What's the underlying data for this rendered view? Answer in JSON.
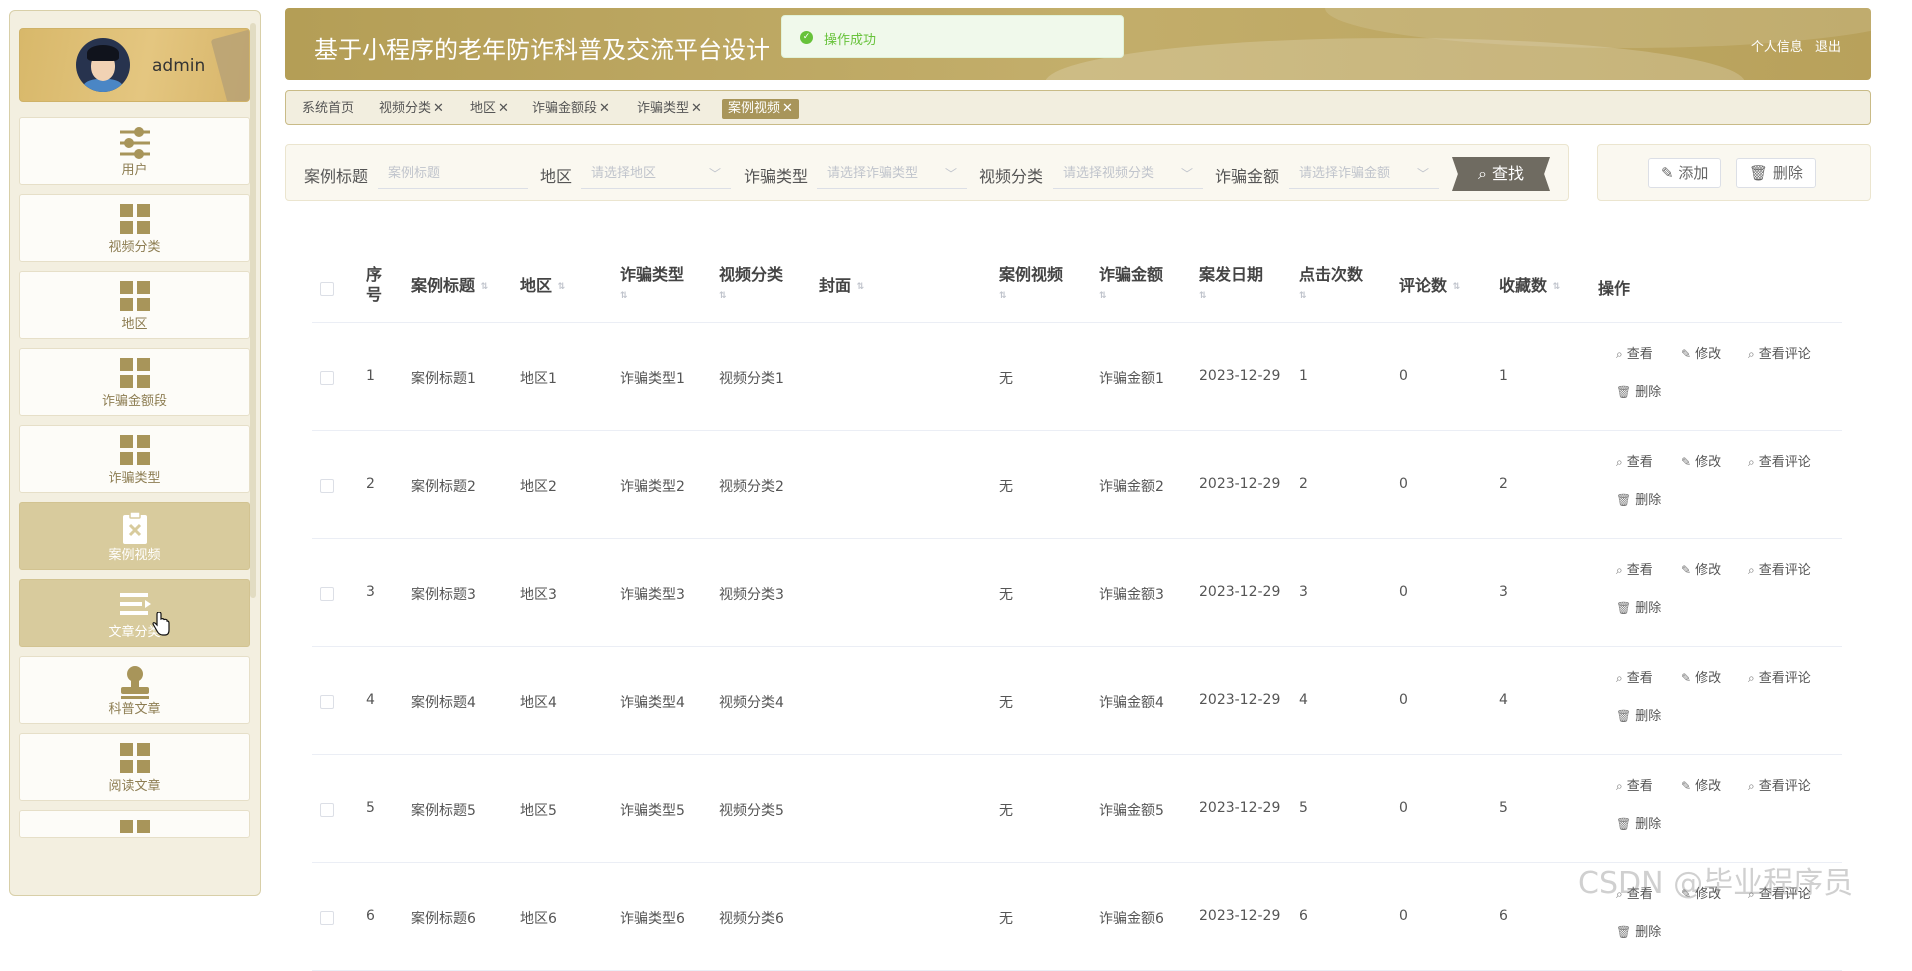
{
  "user": {
    "name": "admin"
  },
  "menu": [
    {
      "label": "用户",
      "icon": "sliders-icon",
      "active": false
    },
    {
      "label": "视频分类",
      "icon": "grid-icon",
      "active": false
    },
    {
      "label": "地区",
      "icon": "grid-icon",
      "active": false
    },
    {
      "label": "诈骗金额段",
      "icon": "grid-icon",
      "active": false
    },
    {
      "label": "诈骗类型",
      "icon": "grid-icon",
      "active": false
    },
    {
      "label": "案例视频",
      "icon": "clipboard-x-icon",
      "active": true
    },
    {
      "label": "文章分类",
      "icon": "list-icon",
      "active": true
    },
    {
      "label": "科普文章",
      "icon": "stamp-icon",
      "active": false
    },
    {
      "label": "阅读文章",
      "icon": "grid-icon",
      "active": false
    }
  ],
  "header": {
    "title": "基于小程序的老年防诈科普及交流平台设计",
    "profile_link": "个人信息",
    "logout_link": "退出"
  },
  "toast": {
    "message": "操作成功",
    "icon": "check-circle-icon",
    "color": "#67c23a"
  },
  "tabs": [
    {
      "label": "系统首页",
      "closable": false,
      "active": false
    },
    {
      "label": "视频分类",
      "closable": true,
      "active": false
    },
    {
      "label": "地区",
      "closable": true,
      "active": false
    },
    {
      "label": "诈骗金额段",
      "closable": true,
      "active": false
    },
    {
      "label": "诈骗类型",
      "closable": true,
      "active": false
    },
    {
      "label": "案例视频",
      "closable": true,
      "active": true
    }
  ],
  "search": {
    "title_label": "案例标题",
    "title_placeholder": "案例标题",
    "region_label": "地区",
    "region_placeholder": "请选择地区",
    "type_label": "诈骗类型",
    "type_placeholder": "请选择诈骗类型",
    "category_label": "视频分类",
    "category_placeholder": "请选择视频分类",
    "amount_label": "诈骗金额",
    "amount_placeholder": "请选择诈骗金额",
    "find_button": "查找"
  },
  "actions": {
    "add": "添加",
    "delete": "删除"
  },
  "table": {
    "headers": {
      "index": "序号",
      "title": "案例标题",
      "region": "地区",
      "type": "诈骗类型",
      "category": "视频分类",
      "cover": "封面",
      "video": "案例视频",
      "amount": "诈骗金额",
      "date": "案发日期",
      "clicks": "点击次数",
      "comments": "评论数",
      "favorites": "收藏数",
      "ops": "操作"
    },
    "op_labels": {
      "view": "查看",
      "edit": "修改",
      "view_comments": "查看评论",
      "delete": "删除"
    },
    "rows": [
      {
        "index": "1",
        "title": "案例标题1",
        "region": "地区1",
        "type": "诈骗类型1",
        "category": "视频分类1",
        "video": "无",
        "amount": "诈骗金额1",
        "date": "2023-12-29",
        "clicks": "1",
        "comments": "0",
        "favorites": "1"
      },
      {
        "index": "2",
        "title": "案例标题2",
        "region": "地区2",
        "type": "诈骗类型2",
        "category": "视频分类2",
        "video": "无",
        "amount": "诈骗金额2",
        "date": "2023-12-29",
        "clicks": "2",
        "comments": "0",
        "favorites": "2"
      },
      {
        "index": "3",
        "title": "案例标题3",
        "region": "地区3",
        "type": "诈骗类型3",
        "category": "视频分类3",
        "video": "无",
        "amount": "诈骗金额3",
        "date": "2023-12-29",
        "clicks": "3",
        "comments": "0",
        "favorites": "3"
      },
      {
        "index": "4",
        "title": "案例标题4",
        "region": "地区4",
        "type": "诈骗类型4",
        "category": "视频分类4",
        "video": "无",
        "amount": "诈骗金额4",
        "date": "2023-12-29",
        "clicks": "4",
        "comments": "0",
        "favorites": "4"
      },
      {
        "index": "5",
        "title": "案例标题5",
        "region": "地区5",
        "type": "诈骗类型5",
        "category": "视频分类5",
        "video": "无",
        "amount": "诈骗金额5",
        "date": "2023-12-29",
        "clicks": "5",
        "comments": "0",
        "favorites": "5"
      },
      {
        "index": "6",
        "title": "案例标题6",
        "region": "地区6",
        "type": "诈骗类型6",
        "category": "视频分类6",
        "video": "无",
        "amount": "诈骗金额6",
        "date": "2023-12-29",
        "clicks": "6",
        "comments": "0",
        "favorites": "6"
      }
    ]
  },
  "watermark": "CSDN @毕业程序员",
  "colors": {
    "accent": "#b49e56",
    "active_menu": "#d8cb9d",
    "active_tab": "#a8955a",
    "find_button": "#6f6b61"
  }
}
